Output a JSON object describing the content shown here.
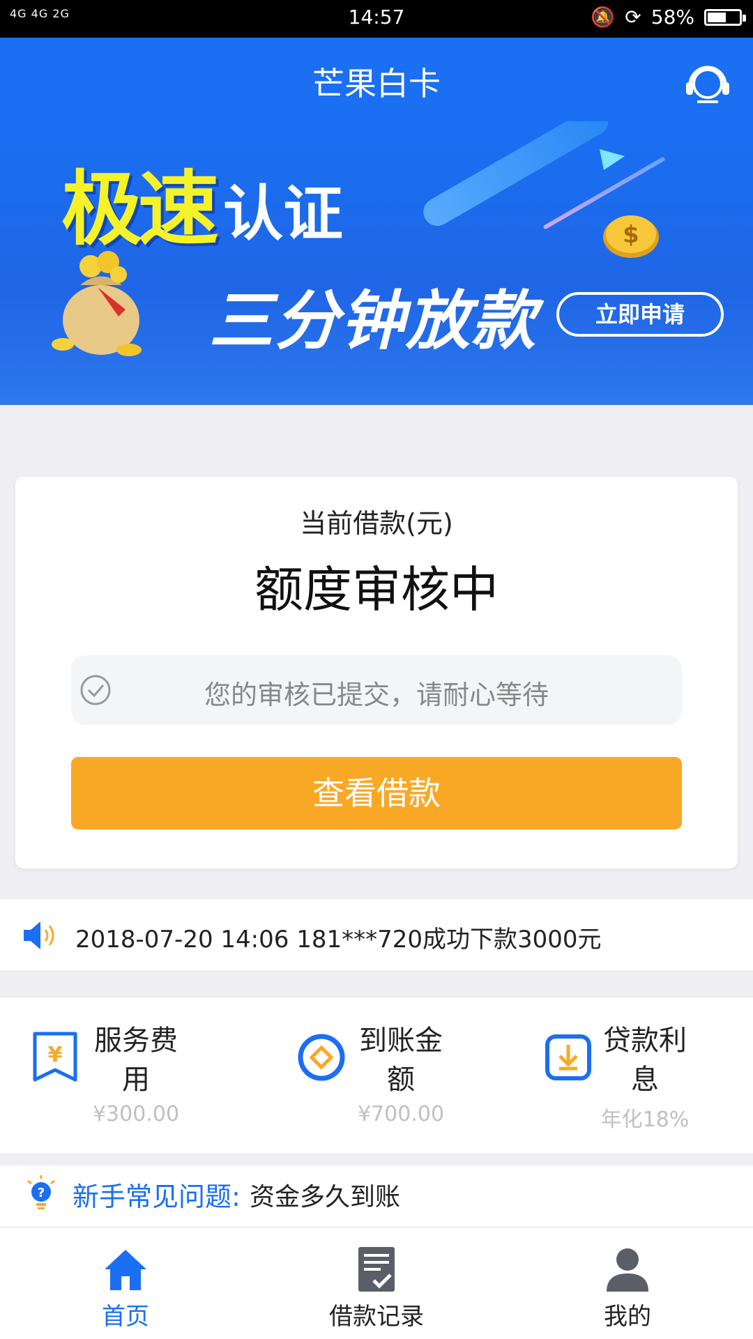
{
  "status_bar": {
    "network": "4G 4G 2G",
    "time": "14:57",
    "battery": "58%",
    "battery_level": 0.58
  },
  "header": {
    "title": "芒果白卡",
    "support_icon": "headset-icon"
  },
  "banner": {
    "headline_highlight": "极速",
    "headline_rest": "认证",
    "subline": "三分钟放款",
    "cta_label": "立即申请"
  },
  "loan_card": {
    "caption": "当前借款(元)",
    "status": "额度审核中",
    "notice": "您的审核已提交，请耐心等待",
    "button_label": "查看借款"
  },
  "ticker": {
    "message": "2018-07-20 14:06 181***720成功下款3000元"
  },
  "features": [
    {
      "label_line1": "服务费",
      "label_line2": "用",
      "value": "¥300.00",
      "icon": "yen-bookmark-icon"
    },
    {
      "label_line1": "到账金",
      "label_line2": "额",
      "value": "¥700.00",
      "icon": "diamond-circle-icon"
    },
    {
      "label_line1": "贷款利",
      "label_line2": "息",
      "value": "年化18%",
      "icon": "download-box-icon"
    }
  ],
  "faq": {
    "prefix": "新手常见问题:",
    "question": "资金多久到账"
  },
  "tabbar": [
    {
      "label": "首页",
      "icon": "home-icon",
      "active": true
    },
    {
      "label": "借款记录",
      "icon": "document-check-icon",
      "active": false
    },
    {
      "label": "我的",
      "icon": "user-icon",
      "active": false
    }
  ],
  "colors": {
    "primary": "#1a6ff2",
    "accent": "#f9a826",
    "muted": "#c0c0c4"
  }
}
